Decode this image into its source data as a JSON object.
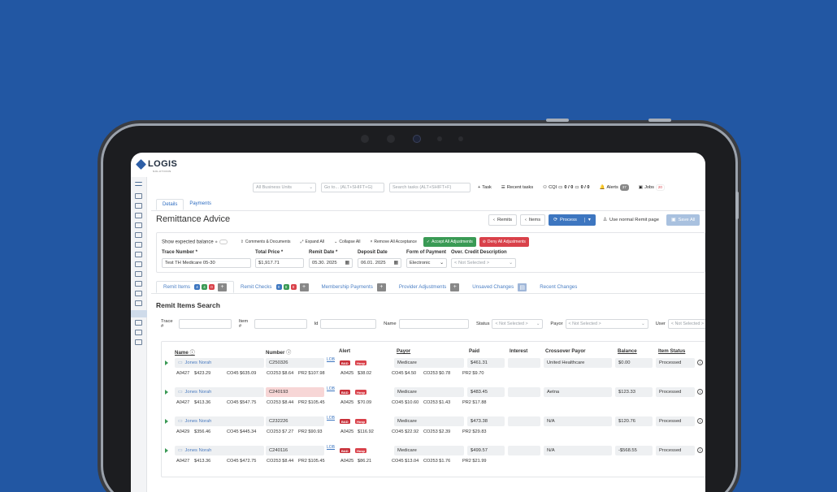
{
  "app": {
    "logo": "LOGIS",
    "logo_sub": "SOLUTIONS"
  },
  "topbar": {
    "business_units": "All Business Units",
    "goto": "Go to... (ALT+SHIFT+G)",
    "search_tasks": "Search tasks (ALT+SHIFT+F)",
    "task": "Task",
    "recent_tasks": "Recent tasks",
    "cqi": "CQI",
    "cqi_a": "0 / 0",
    "cqi_b": "0 / 0",
    "alerts": "Alerts",
    "alerts_count": "37",
    "jobs": "Jobs",
    "jobs_count": "20"
  },
  "tabs": [
    "Details",
    "Payments"
  ],
  "page_title": "Remittance Advice",
  "actions": {
    "remits": "Remits",
    "items": "Items",
    "process": "Process",
    "use_normal": "Use normal Remit page",
    "save_all": "Save All"
  },
  "toolbar": {
    "show_expected": "Show expected balance",
    "comments": "Comments & Documents",
    "expand": "Expand All",
    "collapse": "Collapse All",
    "remove": "Remove All Acceptance",
    "accept": "Accept All Adjustments",
    "deny": "Deny All Adjustments"
  },
  "form": {
    "trace_label": "Trace Number *",
    "trace_value": "Test TH Medicare 05-30",
    "total_label": "Total Price *",
    "total_value": "$1,917.71",
    "remit_date_label": "Remit Date *",
    "remit_date_value": "05.30. 2025",
    "deposit_label": "Deposit Date",
    "deposit_value": "06.01. 2025",
    "form_label": "Form of Payment",
    "form_value": "Electronic",
    "over_label": "Over. Credit Description",
    "over_value": "< Not Selected >"
  },
  "subtabs": {
    "remit_items": "Remit Items",
    "remit_items_badges": [
      "4",
      "4",
      "0"
    ],
    "remit_checks": "Remit Checks",
    "remit_checks_badges": [
      "0",
      "0",
      "0"
    ],
    "membership": "Membership Payments",
    "provider": "Provider Adjustments",
    "unsaved": "Unsaved Changes",
    "recent": "Recent Changes"
  },
  "search": {
    "title": "Remit Items Search",
    "trace": "Trace #",
    "item": "Item #",
    "id": "Id",
    "name": "Name",
    "status": "Status",
    "status_val": "< Not Selected >",
    "payor": "Payor",
    "payor_val": "< Not Selected >",
    "user": "User",
    "user_val": "< Not Selected >"
  },
  "columns": {
    "name": "Name",
    "number": "Number",
    "alert": "Alert",
    "payor": "Payor",
    "paid": "Paid",
    "interest": "Interest",
    "crossover": "Crossover Payor",
    "balance": "Balance",
    "status": "Item Status"
  },
  "rows": [
    {
      "name": "Jones Norah",
      "number": "C250326",
      "lob": "LOB",
      "bad": "BAD",
      "hosp": "Hosp",
      "payor": "Medicare",
      "paid": "$461.31",
      "crossover": "United Healthcare",
      "balance": "$0.00",
      "status": "Processed",
      "d1": "A0427",
      "d2": "$423.29",
      "d3": "CO45 $635.09",
      "d4": "CO253 $8.64",
      "d5": "PR2 $107.98",
      "d6": "A0425",
      "d7": "$38.02",
      "d8": "CO45 $4.50",
      "d9": "CO253 $0.78",
      "d10": "PR2 $9.70"
    },
    {
      "name": "Jones Norah",
      "number": "C240193",
      "lob": "LOB",
      "bad": "BAD",
      "hosp": "Hosp",
      "payor": "Medicare",
      "paid": "$483.45",
      "crossover": "Aetna",
      "balance": "$123.33",
      "status": "Processed",
      "d1": "A0427",
      "d2": "$413.36",
      "d3": "CO45 $547.75",
      "d4": "CO253 $8.44",
      "d5": "PR2 $105.45",
      "d6": "A0425",
      "d7": "$70.09",
      "d8": "CO45 $10.60",
      "d9": "CO253 $1.43",
      "d10": "PR2 $17.88"
    },
    {
      "name": "Jones Norah",
      "number": "C232226",
      "lob": "LOB",
      "bad": "BAD",
      "hosp": "Hosp",
      "payor": "Medicare",
      "paid": "$473.38",
      "crossover": "N/A",
      "balance": "$120.76",
      "status": "Processed",
      "d1": "A0429",
      "d2": "$356.46",
      "d3": "CO45 $445.34",
      "d4": "CO253 $7.27",
      "d5": "PR2 $90.93",
      "d6": "A0425",
      "d7": "$116.92",
      "d8": "CO45 $22.92",
      "d9": "CO253 $2.39",
      "d10": "PR2 $29.83"
    },
    {
      "name": "Jones Norah",
      "number": "C240116",
      "lob": "LOB",
      "bad": "BAD",
      "hosp": "Hosp",
      "payor": "Medicare",
      "paid": "$499.57",
      "crossover": "N/A",
      "balance": "-$568.55",
      "status": "Processed",
      "d1": "A0427",
      "d2": "$413.36",
      "d3": "CO45 $472.75",
      "d4": "CO253 $8.44",
      "d5": "PR2 $105.45",
      "d6": "A0425",
      "d7": "$86.21",
      "d8": "CO45 $13.04",
      "d9": "CO253 $1.76",
      "d10": "PR2 $21.99"
    }
  ]
}
